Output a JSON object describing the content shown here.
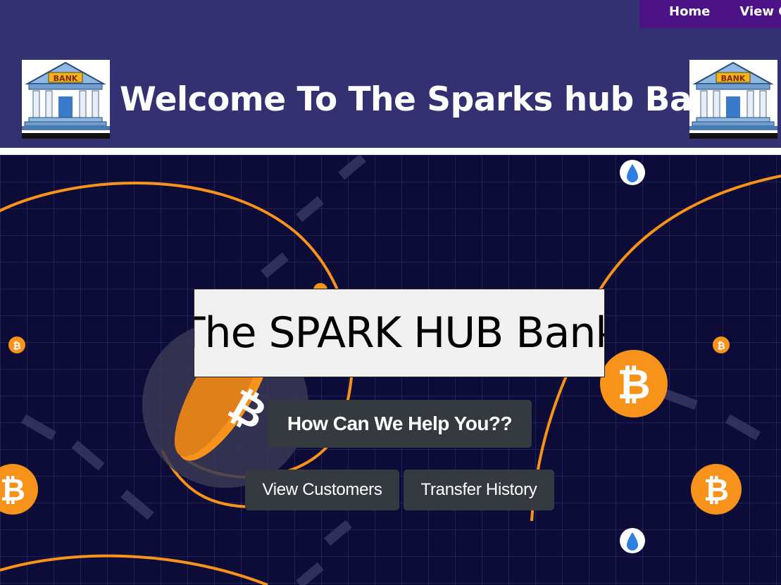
{
  "nav": {
    "items": [
      "Home",
      "View C"
    ]
  },
  "header": {
    "logo_text": "BANK",
    "title": "Welcome To The Sparks hub Bank!!"
  },
  "hero": {
    "title": "The SPARK HUB Bank",
    "help_label": "How Can We Help You??",
    "buttons": {
      "view_customers": "View Customers",
      "transfer_history": "Transfer History"
    }
  },
  "colors": {
    "header_bg": "#343173",
    "nav_bg": "#4c1387",
    "hero_bg": "#0d0b38",
    "accent_orange": "#f7931a",
    "button_bg": "#343a40"
  }
}
